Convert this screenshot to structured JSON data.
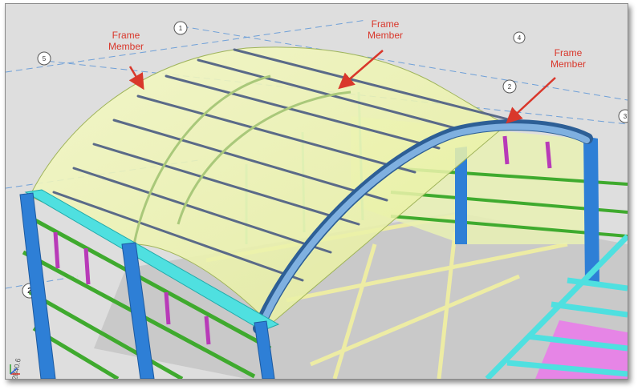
{
  "annotations": [
    {
      "line1": "Frame",
      "line2": "Member"
    },
    {
      "line1": "Frame",
      "line2": "Member"
    },
    {
      "line1": "Frame",
      "line2": "Member"
    }
  ],
  "dimension_text": "2840.6",
  "grid_bubbles": [
    "5",
    "1",
    "2",
    "3",
    "4",
    "2"
  ],
  "colors": {
    "background": "#dcdcdc",
    "roof_glass": "#eef5a8",
    "column_blue": "#2e7fd6",
    "arch_blue": "#4f8ec8",
    "beam_cyan": "#4fe0e0",
    "girt_green": "#3faa2e",
    "brace_magenta": "#b83ab8",
    "floor_grid_yellow": "#f1f0a0",
    "annotation_red": "#d9372b"
  }
}
